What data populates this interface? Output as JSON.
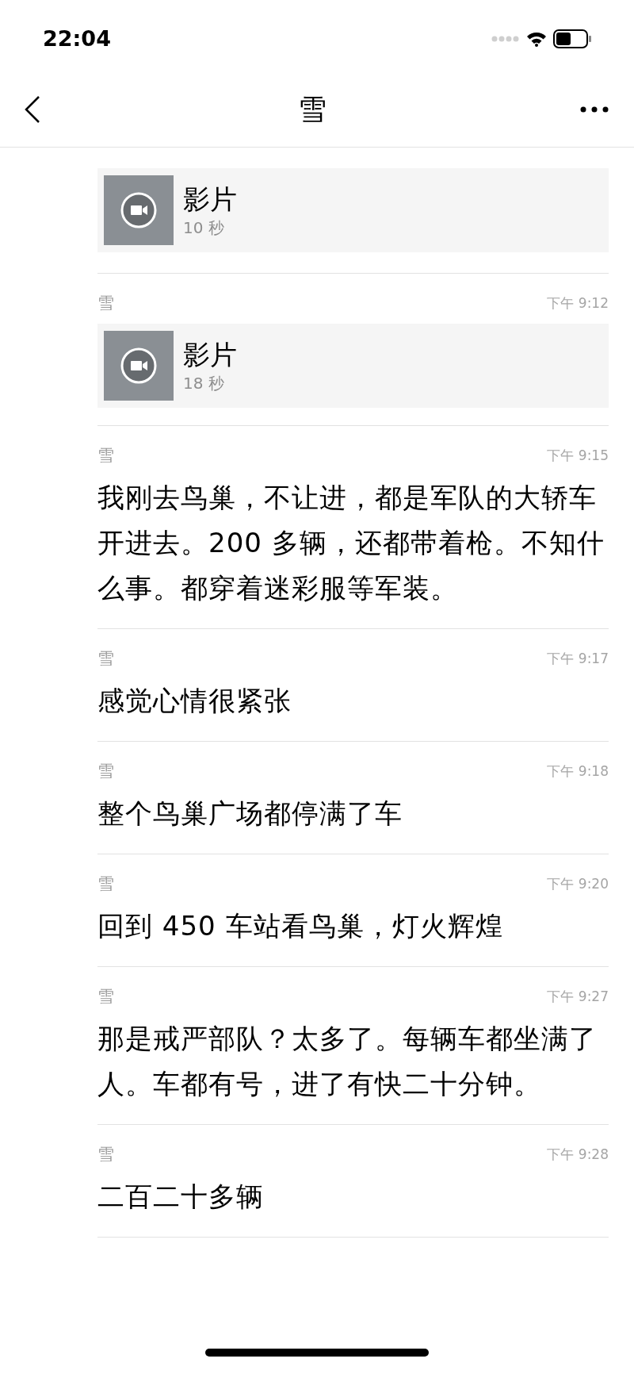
{
  "status_bar": {
    "time": "22:04"
  },
  "header": {
    "title": "雪"
  },
  "messages": [
    {
      "kind": "video",
      "label": "影片",
      "duration": "10 秒"
    },
    {
      "kind": "video",
      "sender": "雪",
      "time": "下午 9:12",
      "label": "影片",
      "duration": "18 秒"
    },
    {
      "kind": "text",
      "sender": "雪",
      "time": "下午 9:15",
      "text": "我刚去鸟巢，不让进，都是军队的大轿车开进去。200 多辆，还都带着枪。不知什么事。都穿着迷彩服等军装。"
    },
    {
      "kind": "text",
      "sender": "雪",
      "time": "下午 9:17",
      "text": "感觉心情很紧张"
    },
    {
      "kind": "text",
      "sender": "雪",
      "time": "下午 9:18",
      "text": "整个鸟巢广场都停满了车"
    },
    {
      "kind": "text",
      "sender": "雪",
      "time": "下午 9:20",
      "text": "回到 450 车站看鸟巢，灯火辉煌"
    },
    {
      "kind": "text",
      "sender": "雪",
      "time": "下午 9:27",
      "text": "那是戒严部队？太多了。每辆车都坐满了人。车都有号，进了有快二十分钟。"
    },
    {
      "kind": "text",
      "sender": "雪",
      "time": "下午 9:28",
      "text": "二百二十多辆"
    }
  ]
}
